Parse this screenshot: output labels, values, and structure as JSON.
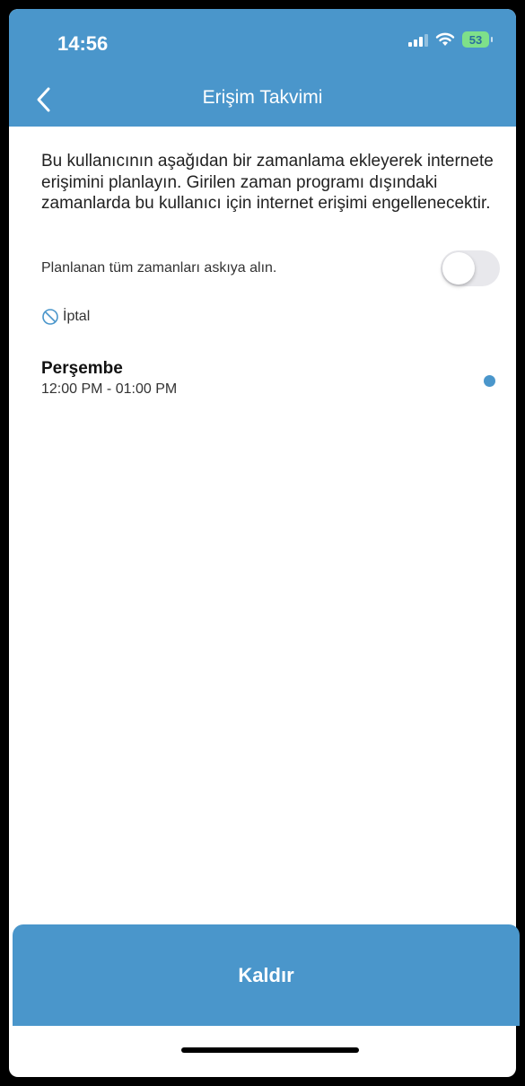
{
  "status_bar": {
    "time": "14:56",
    "battery": "53"
  },
  "header": {
    "title": "Erişim Takvimi",
    "back_icon": "chevron-left-icon"
  },
  "description": "Bu kullanıcının aşağıdan bir zamanlama ekleyerek internete erişimini planlayın. Girilen zaman programı dışındaki zamanlarda bu kullanıcı için internet erişimi engellenecektir.",
  "suspend": {
    "label": "Planlanan tüm zamanları askıya alın.",
    "enabled": false
  },
  "cancel": {
    "label": "İptal",
    "icon": "prohibited-icon"
  },
  "schedules": [
    {
      "day": "Perşembe",
      "time": "12:00 PM - 01:00 PM"
    }
  ],
  "remove_button": {
    "label": "Kaldır"
  },
  "colors": {
    "accent": "#4a96cb",
    "battery": "#7ee08a"
  }
}
